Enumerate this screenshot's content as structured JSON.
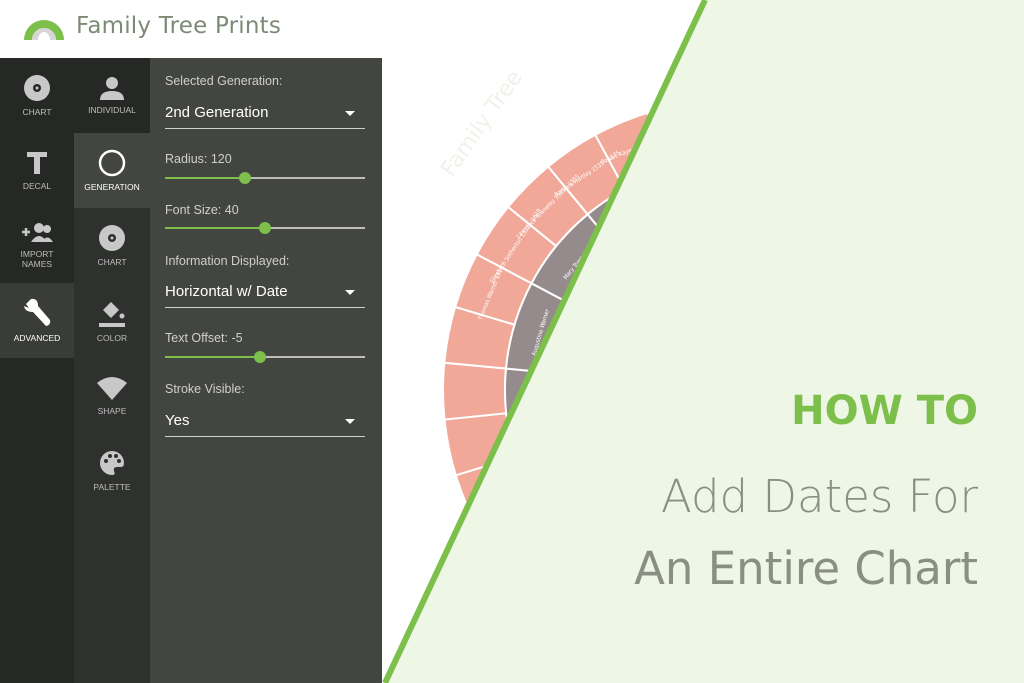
{
  "brand": {
    "name": "Family Tree Prints",
    "watermark": "Family Tree",
    "green": "#7cbf4a",
    "gray": "#7d8a75"
  },
  "nav_primary": [
    {
      "label": "CHART",
      "icon": "disc-icon"
    },
    {
      "label": "DECAL",
      "icon": "text-icon"
    },
    {
      "label": "IMPORT NAMES",
      "icon": "add-people-icon"
    },
    {
      "label": "ADVANCED",
      "icon": "wrench-icon",
      "active": true
    }
  ],
  "nav_secondary": [
    {
      "label": "INDIVIDUAL",
      "icon": "person-icon"
    },
    {
      "label": "GENERATION",
      "icon": "circle-icon",
      "active": true
    },
    {
      "label": "CHART",
      "icon": "disc-icon"
    },
    {
      "label": "COLOR",
      "icon": "paint-bucket-icon"
    },
    {
      "label": "SHAPE",
      "icon": "wedge-icon"
    },
    {
      "label": "PALETTE",
      "icon": "palette-icon"
    }
  ],
  "panel": {
    "selected_generation_label": "Selected Generation:",
    "selected_generation": "2nd Generation",
    "radius_label": "Radius: 120",
    "radius_fraction": 0.4,
    "font_size_label": "Font Size: 40",
    "font_size_fraction": 0.5,
    "info_label": "Information Displayed:",
    "info_value": "Horizontal w/ Date",
    "text_offset_label": "Text Offset: -5",
    "text_offset_fraction": 0.475,
    "stroke_label": "Stroke Visible:",
    "stroke_value": "Yes"
  },
  "fan_chart": {
    "outer_color": "#f2a898",
    "inner_color": "#958b8c",
    "outer_names": [
      "Thomas Warner 1510 -",
      "Elizabeth Sotherton 1512 - 1629",
      "Lawrence Towneley 1535 - 1555",
      "Barbara Hartley 1535 - 1575",
      "Robert Kaye 1535 - 1593",
      "Augustine Warner 1535 - 1593"
    ],
    "inner_names": [
      "Augustine Warner",
      "Mary Towneley"
    ]
  },
  "hero": {
    "kicker": "HOW TO",
    "line1": "Add Dates For",
    "line2": "An Entire Chart"
  }
}
